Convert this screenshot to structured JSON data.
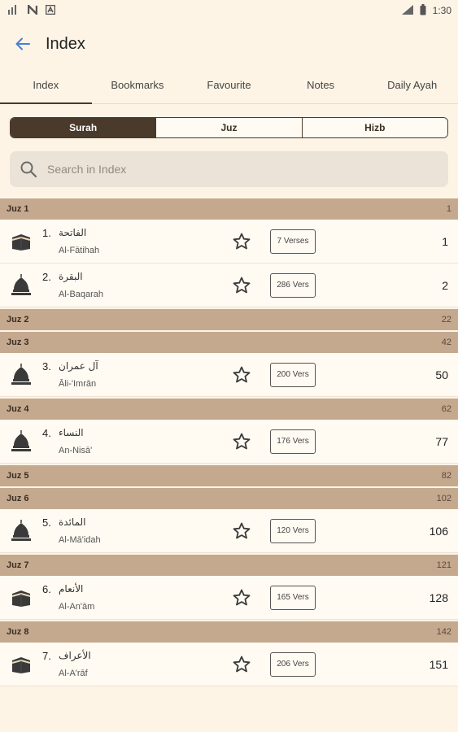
{
  "status": {
    "time": "1:30",
    "icons": [
      "signal-icon",
      "n-icon",
      "a-icon"
    ]
  },
  "appbar": {
    "title": "Index"
  },
  "tabs": [
    {
      "label": "Index",
      "active": true
    },
    {
      "label": "Bookmarks",
      "active": false
    },
    {
      "label": "Favourite",
      "active": false
    },
    {
      "label": "Notes",
      "active": false
    },
    {
      "label": "Daily Ayah",
      "active": false
    }
  ],
  "segments": [
    {
      "label": "Surah",
      "active": true
    },
    {
      "label": "Juz",
      "active": false
    },
    {
      "label": "Hizb",
      "active": false
    }
  ],
  "search": {
    "placeholder": "Search in Index"
  },
  "list": [
    {
      "kind": "juz",
      "label": "Juz 1",
      "page": "1"
    },
    {
      "kind": "surah",
      "num": "1.",
      "arabic": "الفاتحة",
      "latin": "Al-Fātihah",
      "icon": "kaaba-icon",
      "verses": "7 Verses",
      "page": "1"
    },
    {
      "kind": "surah",
      "num": "2.",
      "arabic": "البقرة",
      "latin": "Al-Baqarah",
      "icon": "mosque-icon",
      "verses": "286 Vers",
      "page": "2"
    },
    {
      "kind": "juz",
      "label": "Juz 2",
      "page": "22"
    },
    {
      "kind": "juz",
      "label": "Juz 3",
      "page": "42"
    },
    {
      "kind": "surah",
      "num": "3.",
      "arabic": "آل عمران",
      "latin": "Āli-'Imrān",
      "icon": "mosque-icon",
      "verses": "200 Vers",
      "page": "50"
    },
    {
      "kind": "juz",
      "label": "Juz 4",
      "page": "62"
    },
    {
      "kind": "surah",
      "num": "4.",
      "arabic": "النساء",
      "latin": "An-Nisā'",
      "icon": "mosque-icon",
      "verses": "176 Vers",
      "page": "77"
    },
    {
      "kind": "juz",
      "label": "Juz 5",
      "page": "82"
    },
    {
      "kind": "juz",
      "label": "Juz 6",
      "page": "102"
    },
    {
      "kind": "surah",
      "num": "5.",
      "arabic": "المائدة",
      "latin": "Al-Mā'idah",
      "icon": "mosque-icon",
      "verses": "120 Vers",
      "page": "106"
    },
    {
      "kind": "juz",
      "label": "Juz 7",
      "page": "121"
    },
    {
      "kind": "surah",
      "num": "6.",
      "arabic": "الأنعام",
      "latin": "Al-An'ām",
      "icon": "kaaba-icon",
      "verses": "165 Vers",
      "page": "128"
    },
    {
      "kind": "juz",
      "label": "Juz 8",
      "page": "142"
    },
    {
      "kind": "surah",
      "num": "7.",
      "arabic": "الأعراف",
      "latin": "Al-A'rāf",
      "icon": "kaaba-icon",
      "verses": "206 Vers",
      "page": "151"
    }
  ],
  "colors": {
    "background": "#fdf4e6",
    "juz_header": "#c4a98f",
    "accent": "#4a3a2c",
    "back_arrow": "#4a7fd1"
  }
}
